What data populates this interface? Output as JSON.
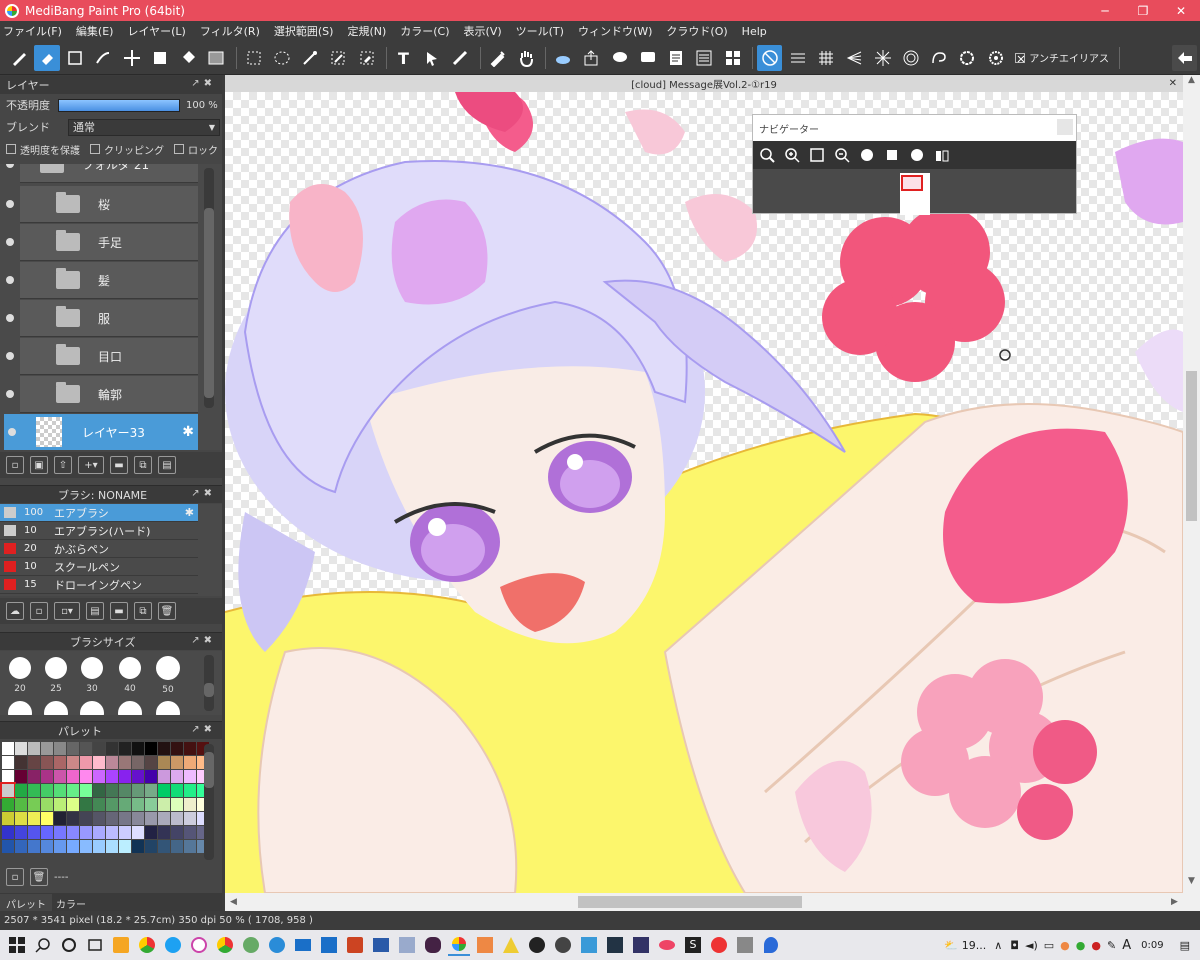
{
  "window": {
    "title": "MediBang Paint Pro (64bit)"
  },
  "menu": [
    "ファイル(F)",
    "編集(E)",
    "レイヤー(L)",
    "フィルタ(R)",
    "選択範囲(S)",
    "定規(N)",
    "カラー(C)",
    "表示(V)",
    "ツール(T)",
    "ウィンドウ(W)",
    "クラウド(O)",
    "Help"
  ],
  "toolbar": {
    "antialias_label": "アンチエイリアス"
  },
  "layers_panel": {
    "title": "レイヤー",
    "opacity_label": "不透明度",
    "opacity_value": "100 %",
    "opacity_fraction": 1.0,
    "blend_label": "ブレンド",
    "blend_value": "通常",
    "protect_alpha": "透明度を保護",
    "clipping": "クリッピング",
    "lock": "ロック",
    "partial_folder": "フォルダ 21",
    "layers": [
      {
        "name": "桜",
        "type": "folder"
      },
      {
        "name": "手足",
        "type": "folder"
      },
      {
        "name": "髪",
        "type": "folder"
      },
      {
        "name": "服",
        "type": "folder"
      },
      {
        "name": "目口",
        "type": "folder"
      },
      {
        "name": "輪郭",
        "type": "folder"
      },
      {
        "name": "レイヤー33",
        "type": "layer",
        "selected": true
      }
    ]
  },
  "brush_panel": {
    "title": "ブラシ: NONAME",
    "brushes": [
      {
        "size": "100",
        "name": "エアブラシ",
        "color": "#cccccc",
        "selected": true
      },
      {
        "size": "10",
        "name": "エアブラシ(ハード)",
        "color": "#cccccc"
      },
      {
        "size": "20",
        "name": "かぶらペン",
        "color": "#e02020"
      },
      {
        "size": "10",
        "name": "スクールペン",
        "color": "#e02020"
      },
      {
        "size": "15",
        "name": "ドローイングペン",
        "color": "#e02020"
      }
    ]
  },
  "brush_size_panel": {
    "title": "ブラシサイズ",
    "sizes": [
      "20",
      "25",
      "30",
      "40",
      "50"
    ]
  },
  "palette_panel": {
    "title": "パレット",
    "footer": "----",
    "tabs": [
      "パレット",
      "カラー"
    ]
  },
  "document": {
    "tab_title": "[cloud] Message展Vol.2-①r19"
  },
  "navigator": {
    "title": "ナビゲーター"
  },
  "status": {
    "text": "2507 * 3541 pixel   (18.2 * 25.7cm)   350 dpi   50 %   ( 1708, 958 )"
  },
  "taskbar": {
    "weather": "19...",
    "ime": "A",
    "time": "0:09"
  }
}
